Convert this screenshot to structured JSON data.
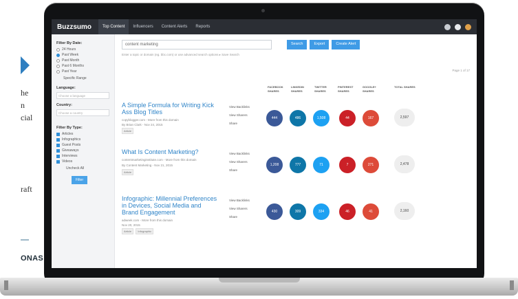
{
  "fragment": {
    "lines": [
      "he",
      "n",
      "cial",
      "raft"
    ],
    "footer": "ONAS"
  },
  "app": {
    "brand": "Buzzsumo",
    "nav": [
      "Top Content",
      "Influencers",
      "Content Alerts",
      "Reports"
    ],
    "search": {
      "value": "content marketing",
      "buttons": [
        "Search",
        "Export",
        "Create Alert"
      ],
      "hint": "Enter a topic or domain (eg. bbc.com) or use advanced search options  ▸ Save Search"
    },
    "sidebar": {
      "filter_title": "Filter By Date:",
      "date_options": [
        "24 Hours",
        "Past Week",
        "Past Month",
        "Past 6 Months",
        "Past Year"
      ],
      "specific_range": "Specific Range",
      "language_title": "Language:",
      "language_placeholder": "Choose a language",
      "country_title": "Country:",
      "country_placeholder": "Choose a country",
      "type_title": "Filter By Type:",
      "type_options": [
        "Articles",
        "Infographics",
        "Guest Posts",
        "Giveaways",
        "Interviews",
        "Videos"
      ],
      "uncheck_all": "Uncheck All",
      "filter_button": "Filter"
    },
    "sort_text": "Page 1 of 17",
    "columns": [
      "FACEBOOK SHARES",
      "LINKEDIN SHARES",
      "TWITTER SHARES",
      "PINTEREST SHARES",
      "GOOGLE+ SHARES",
      "TOTAL SHARES"
    ],
    "share_colors": [
      "#3b5998",
      "#0e76a8",
      "#1da1f2",
      "#cb2027",
      "#dd4b39"
    ],
    "actions": [
      "View Backlinks",
      "View Sharers",
      "Share"
    ],
    "results": [
      {
        "title": "A Simple Formula for Writing Kick Ass Blog Titles",
        "meta1": "copyblogger.com - More from this domain",
        "meta2": "By Brian Clark - Nov 24, 2015",
        "tags": [
          "Article"
        ],
        "shares": [
          "444",
          "486",
          "1,508",
          "44",
          "167"
        ],
        "total": "2,597"
      },
      {
        "title": "What Is Content Marketing?",
        "meta1": "contentmarketinginstitute.com - More from this domain",
        "meta2": "By Content Marketing - Nov 21, 2015",
        "tags": [
          "Article"
        ],
        "shares": [
          "1,208",
          "777",
          "71",
          "7",
          "271"
        ],
        "total": "2,478"
      },
      {
        "title": "Infographic: Millennial Preferences in Devices, Social Media and Brand Engagement",
        "meta1": "adweek.com - More from this domain",
        "meta2": "Nov 20, 2015",
        "tags": [
          "Article",
          "Infographic"
        ],
        "shares": [
          "430",
          "309",
          "334",
          "46",
          "41"
        ],
        "total": "2,160"
      }
    ]
  }
}
